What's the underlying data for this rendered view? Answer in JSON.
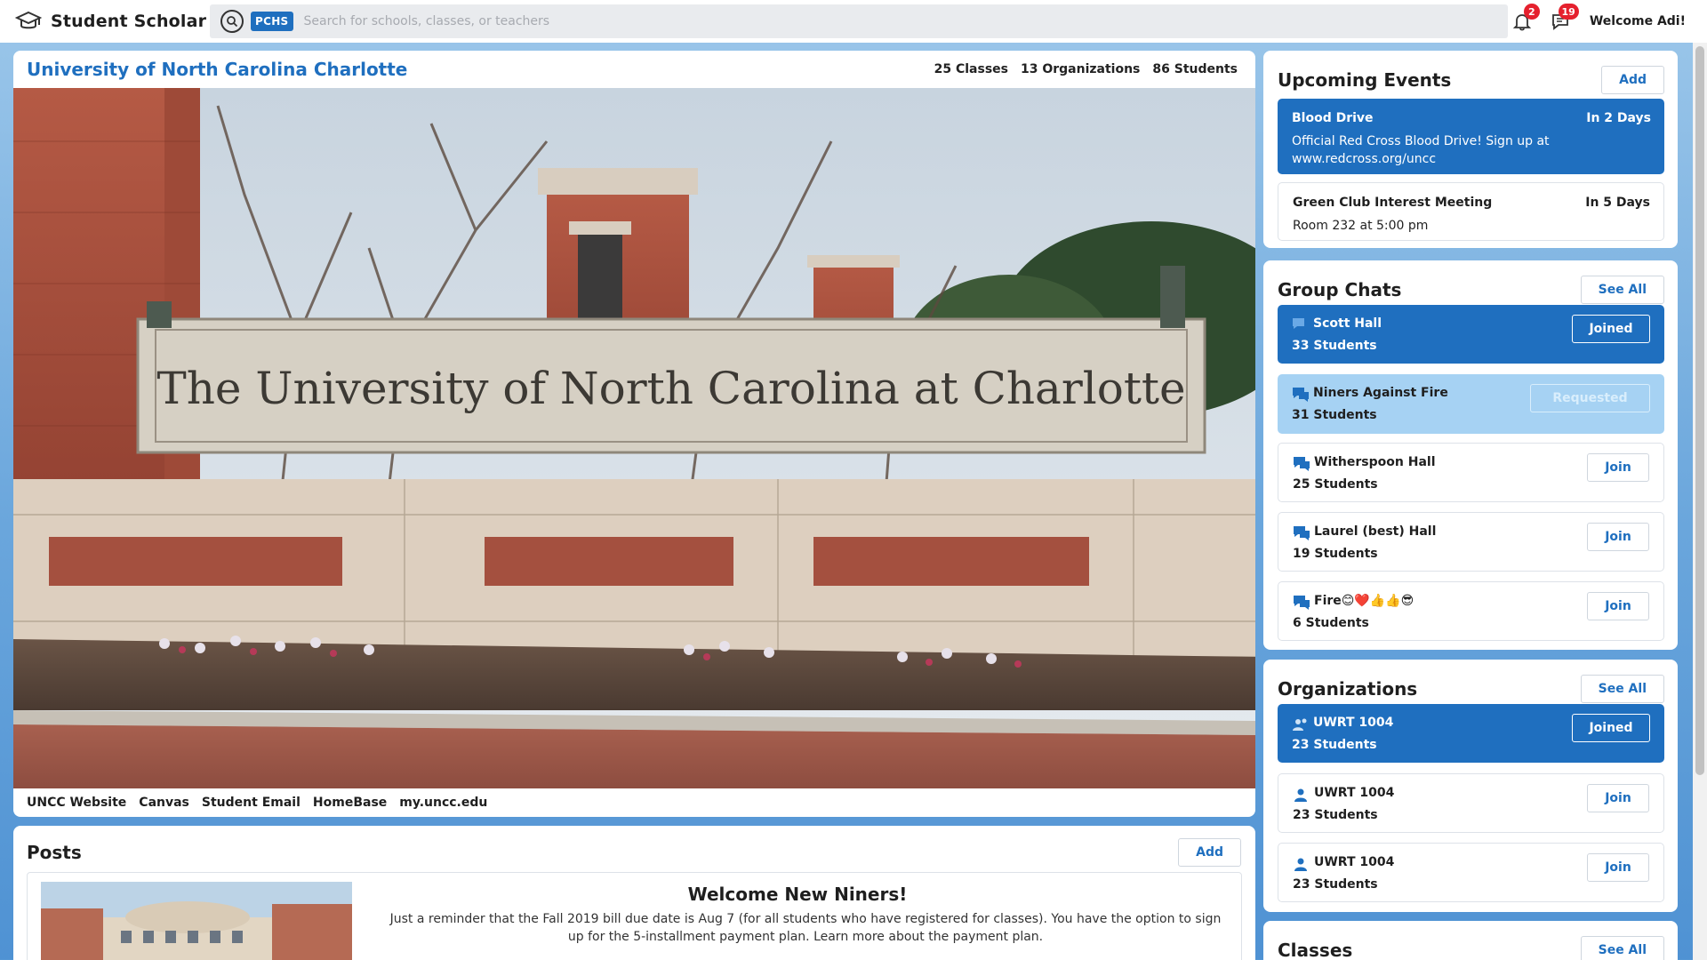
{
  "app": {
    "brand": "Student Scholar",
    "school_code": "PCHS",
    "search_placeholder": "Search for schools, classes, or teachers",
    "notifications_count": "2",
    "messages_count": "19",
    "welcome": "Welcome Adi!"
  },
  "hero": {
    "title": "University of North Carolina Charlotte",
    "stats": {
      "classes": "25 Classes",
      "organizations": "13 Organizations",
      "students": "86 Students"
    },
    "sign_text": "The University of North Carolina at Charlotte",
    "links": [
      "UNCC Website",
      "Canvas",
      "Student Email",
      "HomeBase",
      "my.uncc.edu"
    ]
  },
  "posts": {
    "title": "Posts",
    "add_label": "Add",
    "items": [
      {
        "title": "Welcome New Niners!",
        "text": "Just a reminder that the Fall 2019 bill due date is Aug 7 (for all students who have registered for classes). You have the option to sign up for the 5-installment payment plan. Learn more about the payment plan."
      }
    ]
  },
  "events": {
    "title": "Upcoming Events",
    "add_label": "Add",
    "items": [
      {
        "name": "Blood Drive",
        "when": "In 2 Days",
        "desc": "Official Red Cross Blood Drive! Sign up at www.redcross.org/uncc"
      },
      {
        "name": "Green Club Interest Meeting",
        "when": "In 5 Days",
        "desc": "Room 232 at 5:00 pm"
      }
    ]
  },
  "group_chats": {
    "title": "Group Chats",
    "see_all": "See All",
    "items": [
      {
        "name": "Scott Hall",
        "count": "33 Students",
        "action": "Joined"
      },
      {
        "name": "Niners Against Fire",
        "count": "31 Students",
        "action": "Requested"
      },
      {
        "name": "Witherspoon Hall",
        "count": "25 Students",
        "action": "Join"
      },
      {
        "name": "Laurel (best) Hall",
        "count": "19 Students",
        "action": "Join"
      },
      {
        "name": "Fire😊❤️👍👍😎",
        "count": "6 Students",
        "action": "Join"
      }
    ]
  },
  "organizations": {
    "title": "Organizations",
    "see_all": "See All",
    "items": [
      {
        "name": "UWRT 1004",
        "count": "23 Students",
        "action": "Joined"
      },
      {
        "name": "UWRT 1004",
        "count": "23 Students",
        "action": "Join"
      },
      {
        "name": "UWRT 1004",
        "count": "23 Students",
        "action": "Join"
      }
    ]
  },
  "classes": {
    "title": "Classes",
    "see_all": "See All"
  },
  "colors": {
    "accent": "#1f6fbf",
    "requested": "#a6d2f3",
    "badge": "#e5202d"
  }
}
